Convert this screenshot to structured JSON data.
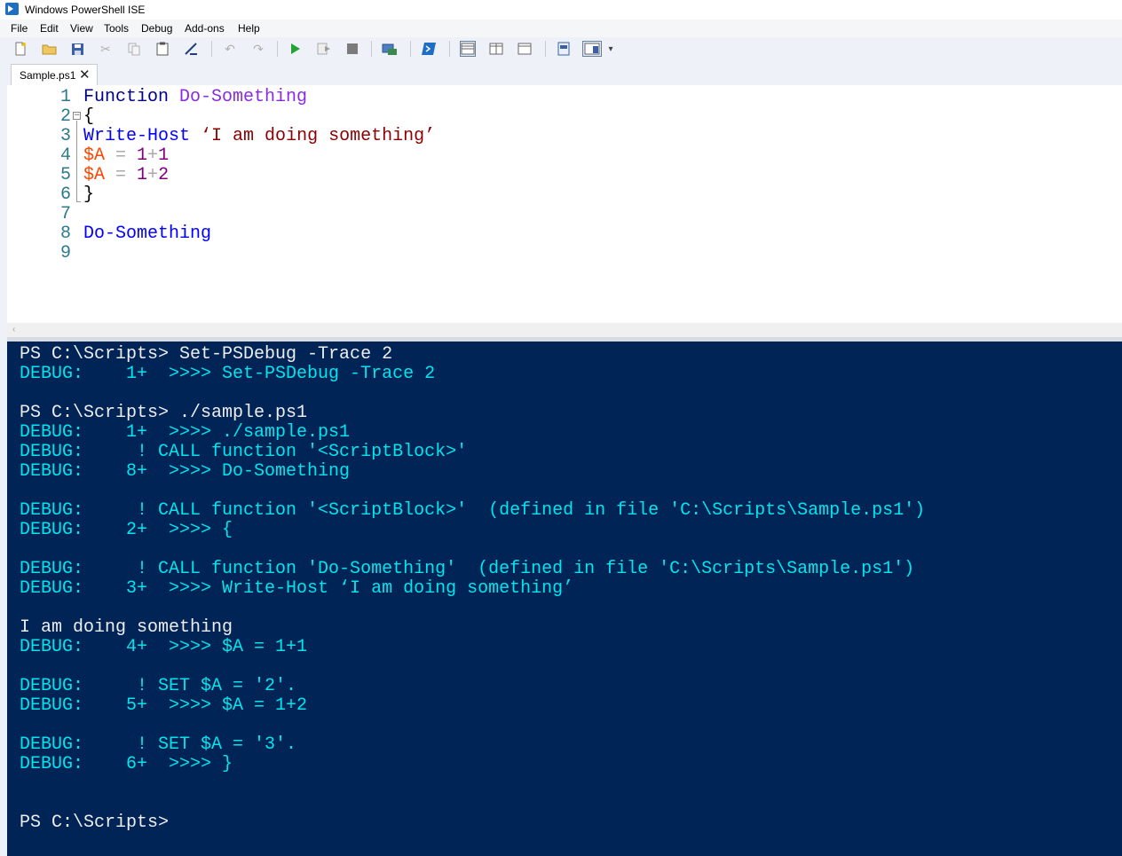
{
  "window": {
    "title": "Windows PowerShell ISE"
  },
  "menu": [
    "File",
    "Edit",
    "View",
    "Tools",
    "Debug",
    "Add-ons",
    "Help"
  ],
  "toolbar": {
    "icons": [
      "new-file-icon",
      "open-folder-icon",
      "save-icon",
      "cut-icon",
      "copy-icon",
      "paste-icon",
      "clear-console-icon",
      "undo-icon",
      "redo-icon",
      "run-script-icon",
      "run-selection-icon",
      "stop-icon",
      "new-remote-tab-icon",
      "powershell-icon",
      "show-script-top-icon",
      "show-script-right-icon",
      "show-script-max-icon",
      "show-commands-icon",
      "command-addon-icon",
      "toolbar-overflow-icon"
    ]
  },
  "tab": {
    "label": "Sample.ps1",
    "close": "✕"
  },
  "editor": {
    "lines": [
      {
        "num": "1",
        "tokens": [
          {
            "t": "Function",
            "c": "kw"
          },
          {
            "t": " ",
            "c": "punc"
          },
          {
            "t": "Do-Something",
            "c": "fn"
          }
        ]
      },
      {
        "num": "2",
        "tokens": [
          {
            "t": "{",
            "c": "punc"
          }
        ]
      },
      {
        "num": "3",
        "tokens": [
          {
            "t": "Write-Host",
            "c": "cmd"
          },
          {
            "t": " ",
            "c": "punc"
          },
          {
            "t": "‘I am doing something’",
            "c": "str"
          }
        ]
      },
      {
        "num": "4",
        "tokens": [
          {
            "t": "$A",
            "c": "var"
          },
          {
            "t": " = ",
            "c": "op"
          },
          {
            "t": "1",
            "c": "num"
          },
          {
            "t": "+",
            "c": "op"
          },
          {
            "t": "1",
            "c": "num"
          }
        ]
      },
      {
        "num": "5",
        "tokens": [
          {
            "t": "$A",
            "c": "var"
          },
          {
            "t": " = ",
            "c": "op"
          },
          {
            "t": "1",
            "c": "num"
          },
          {
            "t": "+",
            "c": "op"
          },
          {
            "t": "2",
            "c": "num"
          }
        ]
      },
      {
        "num": "6",
        "tokens": [
          {
            "t": "}",
            "c": "punc"
          }
        ]
      },
      {
        "num": "7",
        "tokens": []
      },
      {
        "num": "8",
        "tokens": [
          {
            "t": "Do-Something",
            "c": "cmd"
          }
        ]
      },
      {
        "num": "9",
        "tokens": []
      }
    ]
  },
  "console": {
    "lines": [
      {
        "text": "PS C:\\Scripts> Set-PSDebug -Trace 2",
        "color": "white"
      },
      {
        "text": "DEBUG:    1+  >>>> Set-PSDebug -Trace 2",
        "color": "cyan"
      },
      {
        "text": "",
        "color": "white"
      },
      {
        "text": "PS C:\\Scripts> ./sample.ps1",
        "color": "white"
      },
      {
        "text": "DEBUG:    1+  >>>> ./sample.ps1",
        "color": "cyan"
      },
      {
        "text": "DEBUG:     ! CALL function '<ScriptBlock>'",
        "color": "cyan"
      },
      {
        "text": "DEBUG:    8+  >>>> Do-Something",
        "color": "cyan"
      },
      {
        "text": "",
        "color": "white"
      },
      {
        "text": "DEBUG:     ! CALL function '<ScriptBlock>'  (defined in file 'C:\\Scripts\\Sample.ps1')",
        "color": "cyan"
      },
      {
        "text": "DEBUG:    2+  >>>> {",
        "color": "cyan"
      },
      {
        "text": "",
        "color": "white"
      },
      {
        "text": "DEBUG:     ! CALL function 'Do-Something'  (defined in file 'C:\\Scripts\\Sample.ps1')",
        "color": "cyan"
      },
      {
        "text": "DEBUG:    3+  >>>> Write-Host ‘I am doing something’",
        "color": "cyan"
      },
      {
        "text": "",
        "color": "white"
      },
      {
        "text": "I am doing something",
        "color": "white"
      },
      {
        "text": "DEBUG:    4+  >>>> $A = 1+1",
        "color": "cyan"
      },
      {
        "text": "",
        "color": "white"
      },
      {
        "text": "DEBUG:     ! SET $A = '2'.",
        "color": "cyan"
      },
      {
        "text": "DEBUG:    5+  >>>> $A = 1+2",
        "color": "cyan"
      },
      {
        "text": "",
        "color": "white"
      },
      {
        "text": "DEBUG:     ! SET $A = '3'.",
        "color": "cyan"
      },
      {
        "text": "DEBUG:    6+  >>>> }",
        "color": "cyan"
      },
      {
        "text": "",
        "color": "white"
      },
      {
        "text": "",
        "color": "white"
      },
      {
        "text": "PS C:\\Scripts>",
        "color": "white"
      }
    ]
  },
  "colors": {
    "console_bg": "#012456",
    "console_text": "#eeedf0",
    "debug_text": "#00e5ee",
    "keyword": "#00008b",
    "function_name": "#8a2be2",
    "command": "#0000ff",
    "string": "#8b0000",
    "variable": "#ff4500",
    "number": "#800080"
  }
}
